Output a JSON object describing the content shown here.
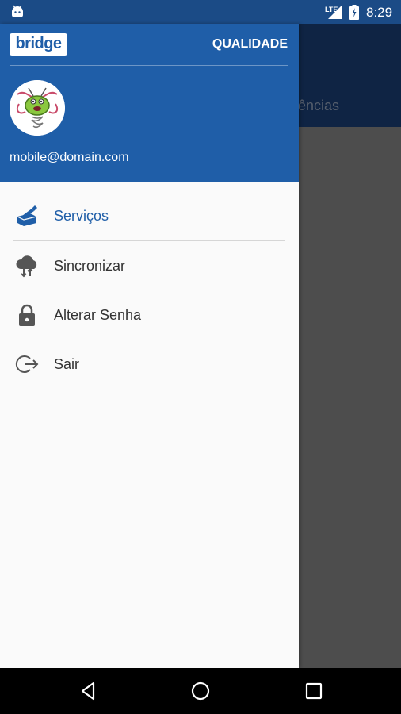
{
  "status_bar": {
    "network": "LTE",
    "time": "8:29"
  },
  "background_app": {
    "tab_label_fragment": "ências"
  },
  "drawer": {
    "logo_text": "bridge",
    "title": "QUALIDADE",
    "user_email": "mobile@domain.com",
    "avatar": "bug-mascot-avatar",
    "items": [
      {
        "label": "Serviços",
        "icon": "services-icon",
        "active": true
      },
      {
        "label": "Sincronizar",
        "icon": "cloud-sync-icon",
        "active": false
      },
      {
        "label": "Alterar Senha",
        "icon": "lock-icon",
        "active": false
      },
      {
        "label": "Sair",
        "icon": "logout-icon",
        "active": false
      }
    ]
  },
  "colors": {
    "primary": "#1f5ea8",
    "status_bar": "#1b4b86",
    "active_text": "#1f5ea8",
    "text": "#333333"
  }
}
